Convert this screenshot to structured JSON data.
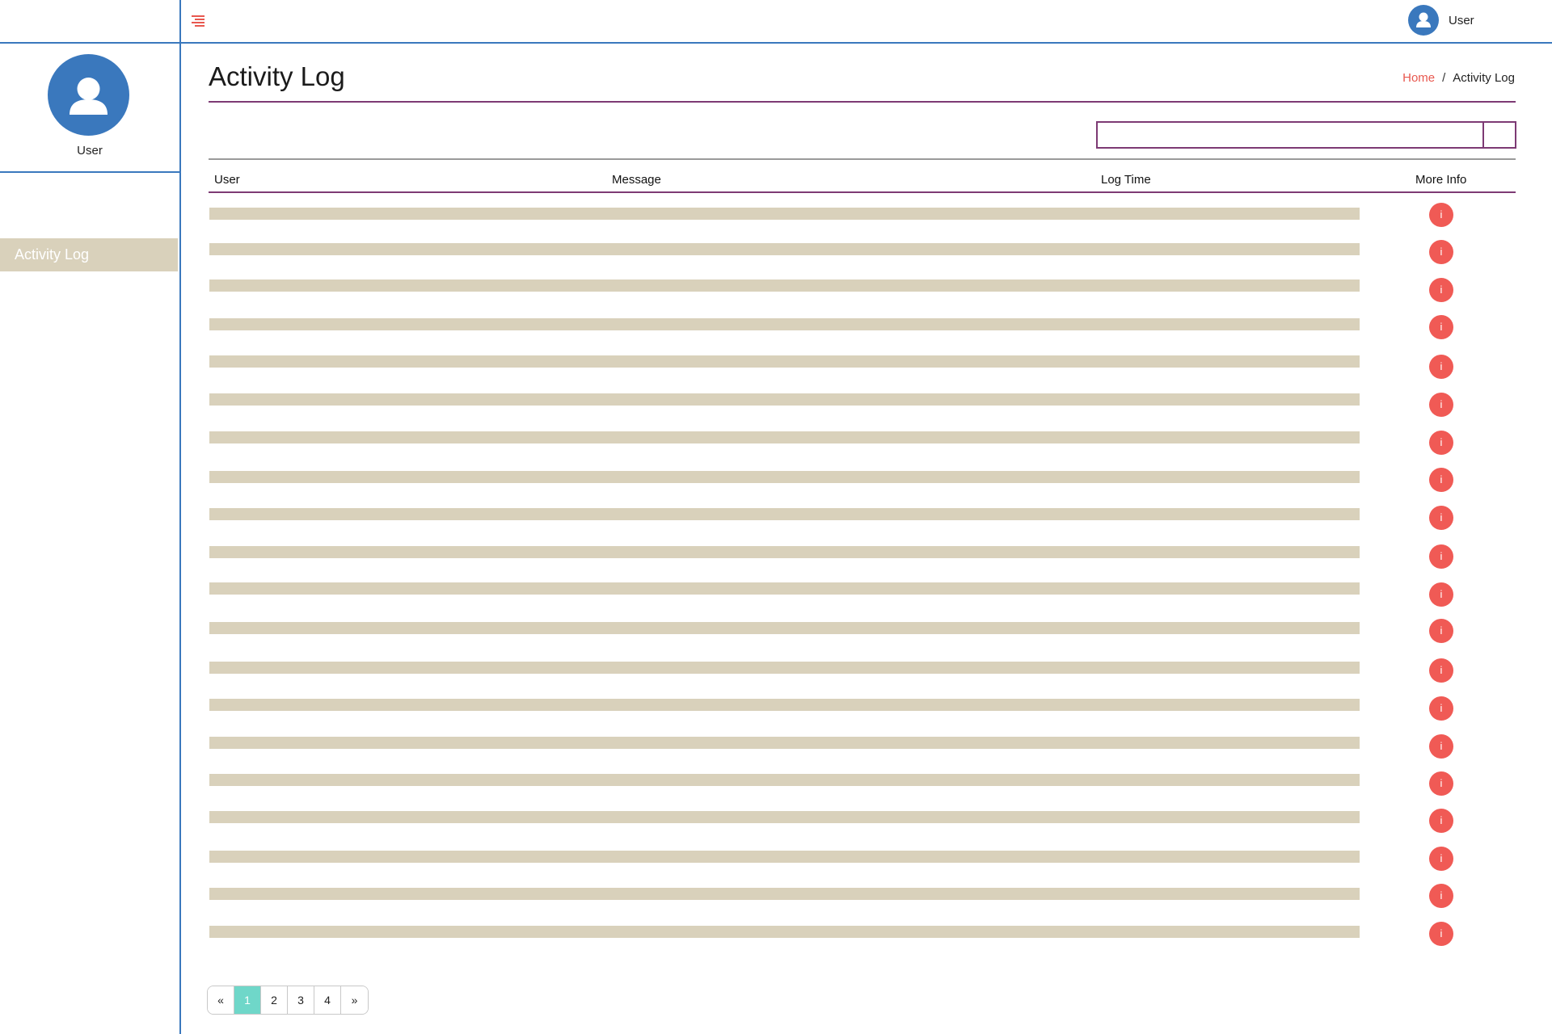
{
  "topbar": {
    "menu_icon": "hamburger-icon",
    "user_name": "User",
    "avatar_icon": "user-avatar-icon"
  },
  "sidebar": {
    "user_name": "User",
    "avatar_icon": "user-avatar-icon",
    "items": [
      {
        "label": "Activity Log",
        "active": true
      }
    ]
  },
  "header": {
    "title": "Activity Log",
    "breadcrumb": {
      "home": "Home",
      "separator": "/",
      "current": "Activity Log"
    }
  },
  "search": {
    "value": "",
    "placeholder": ""
  },
  "table": {
    "columns": [
      "User",
      "Message",
      "Log Time",
      "More Info"
    ],
    "row_count": 20,
    "info_icon_label": "i"
  },
  "pagination": {
    "prev": "«",
    "pages": [
      "1",
      "2",
      "3",
      "4"
    ],
    "current": "1",
    "next": "»"
  },
  "colors": {
    "frame": "#3a78bd",
    "accent_purple": "#7d3a74",
    "placeholder_bar": "#d9d1bb",
    "info_red": "#f05a55",
    "active_page": "#6fd7c9",
    "link_red": "#e8584f"
  }
}
